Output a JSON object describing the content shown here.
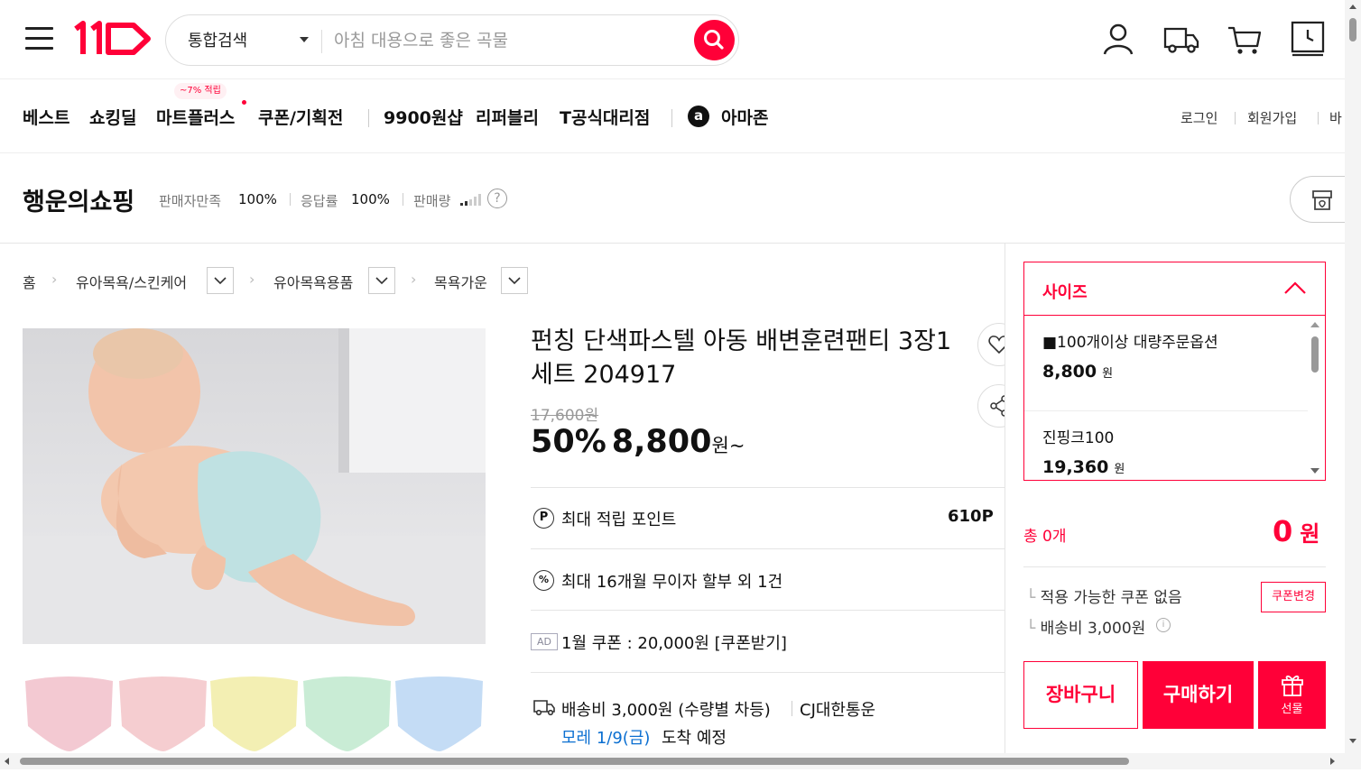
{
  "header": {
    "search_category": "통합검색",
    "search_placeholder": "아침 대용으로 좋은 곡물",
    "logo_text": "11"
  },
  "nav": {
    "items": [
      "베스트",
      "쇼킹딜",
      "마트플러스",
      "쿠폰/기획전",
      "9900원샵",
      "리퍼블리",
      "T공식대리점",
      "아마존"
    ],
    "badge": "~7% 적립",
    "amazon_letter": "a",
    "right_links": [
      "로그인",
      "회원가입",
      "바"
    ]
  },
  "seller": {
    "name": "행운의쇼핑",
    "satisfaction_label": "판매자만족",
    "satisfaction_value": "100%",
    "response_label": "응답률",
    "response_value": "100%",
    "sales_label": "판매량",
    "help": "?"
  },
  "breadcrumb": {
    "home": "홈",
    "level1": "유아목욕/스킨케어",
    "level2": "유아목욕용품",
    "level3": "목욕가운"
  },
  "product": {
    "title": "펀칭 단색파스텔 아동 배변훈련팬티 3장1세트 204917",
    "original_price": "17,600원",
    "discount": "50%",
    "sale_price": "8,800",
    "won_suffix": "원~",
    "points_label": "최대 적립 포인트",
    "points_value": "610P",
    "installment": "최대 16개월 무이자 할부 외 1건",
    "ad_tag": "AD",
    "coupon": "1월 쿠폰 : 20,000원 [쿠폰받기]",
    "shipping": "배송비 3,000원 (수량별 차등)",
    "courier": "CJ대한통운",
    "arrival_date": "모레 1/9(금)",
    "arrival_suffix": "도착 예정",
    "thumb_colors": [
      "#f3c9d2",
      "#f5cdd0",
      "#f3efb3",
      "#c9ecd5",
      "#c4dcf5"
    ]
  },
  "options": {
    "title": "사이즈",
    "items": [
      {
        "name": "■100개이상 대량주문옵션",
        "price": "8,800",
        "unit": "원"
      },
      {
        "name": "진핑크100",
        "price": "19,360",
        "unit": "원"
      }
    ]
  },
  "purchase": {
    "total_label": "총 0개",
    "total_value": "0",
    "total_unit": "원",
    "coupon_note": "적용 가능한 쿠폰 없음",
    "shipping_note": "배송비 3,000원",
    "coupon_change": "쿠폰변경",
    "cart_button": "장바구니",
    "buy_button": "구매하기",
    "gift_button": "선물"
  },
  "colors": {
    "accent": "#ff0038"
  }
}
